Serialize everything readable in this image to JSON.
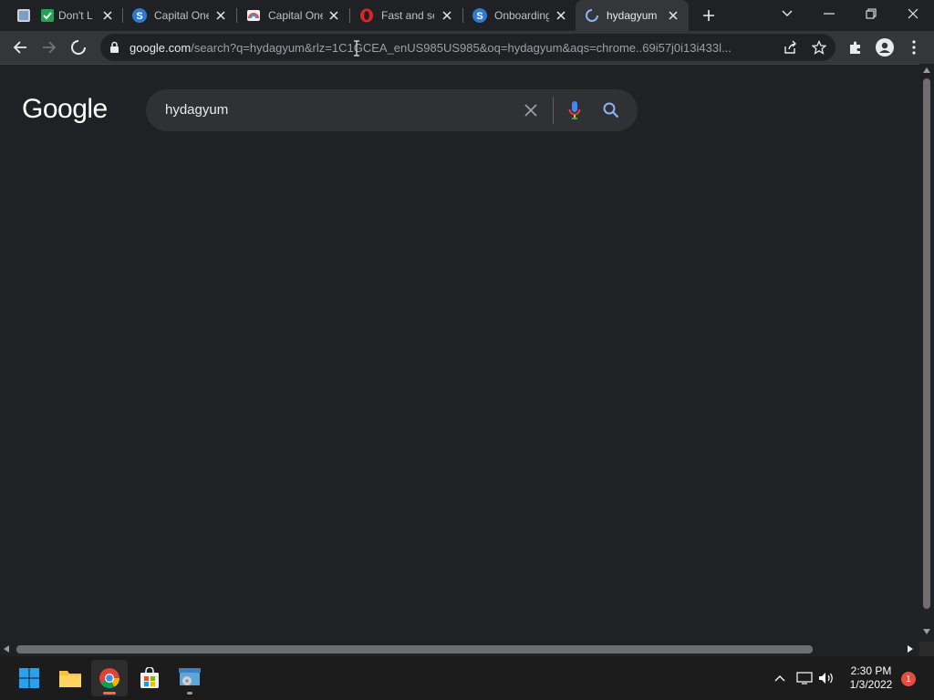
{
  "tabs": [
    {
      "title": "Don't L",
      "favicon": "checkmark-app-icon",
      "active": false
    },
    {
      "title": "Capital One",
      "favicon": "s-logo-icon",
      "active": false
    },
    {
      "title": "Capital One",
      "favicon": "rainbow-icon",
      "active": false
    },
    {
      "title": "Fast and se",
      "favicon": "opera-icon",
      "active": false
    },
    {
      "title": "Onboarding",
      "favicon": "s-logo-icon",
      "active": false
    },
    {
      "title": "hydagyum",
      "favicon": "loading-spinner-icon",
      "active": true
    }
  ],
  "window_controls": [
    "tab-search-icon",
    "minimize-icon",
    "restore-icon",
    "close-icon"
  ],
  "omnibox": {
    "host": "google.com",
    "path": "/search?q=hydagyum&rlz=1C1GCEA_enUS985US985&oq=hydagyum&aqs=chrome..69i57j0i13i433l..."
  },
  "page": {
    "logo": "Google",
    "search_query": "hydagyum"
  },
  "taskbar": {
    "time": "2:30 PM",
    "date": "1/3/2022",
    "notification_count": "1"
  },
  "colors": {
    "background": "#202124",
    "toolbar": "#35363a",
    "searchbox": "#303134",
    "text": "#e8eaed"
  }
}
